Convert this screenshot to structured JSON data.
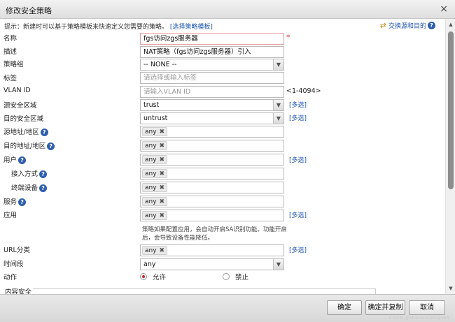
{
  "dialog": {
    "title": "修改安全策略",
    "close_glyph": "×"
  },
  "hint": {
    "text": "提示：新建时可以基于策略模板来快速定义您需要的策略。",
    "link": "[选择策略模板]"
  },
  "swap": {
    "label": "交换源和目的"
  },
  "form": {
    "name": {
      "label": "名称",
      "value": "fgs访问zgs服务器",
      "required": "*"
    },
    "description": {
      "label": "描述",
      "value": "NAT策略（fgs访问zgs服务器）引入"
    },
    "policy_group": {
      "label": "策略组",
      "value": "-- NONE --"
    },
    "tag": {
      "label": "标签",
      "placeholder": "请选择或输入标签"
    },
    "vlan": {
      "label": "VLAN ID",
      "placeholder": "请输入VLAN ID",
      "range": "<1-4094>"
    },
    "src_zone": {
      "label": "源安全区域",
      "value": "trust",
      "more": "[多选]"
    },
    "dst_zone": {
      "label": "目的安全区域",
      "value": "untrust",
      "more": "[多选]"
    },
    "src_addr": {
      "label": "源地址/地区",
      "tag": "any"
    },
    "dst_addr": {
      "label": "目的地址/地区",
      "tag": "any"
    },
    "user": {
      "label": "用户",
      "tag": "any",
      "more": "[多选]"
    },
    "access_mode": {
      "label": "接入方式",
      "tag": "any"
    },
    "terminal": {
      "label": "终端设备",
      "tag": "any"
    },
    "service": {
      "label": "服务",
      "tag": "any"
    },
    "application": {
      "label": "应用",
      "tag": "any",
      "more": "[多选]",
      "note": "策略如果配置应用，会自动开启SA识别功能。功能开启后，会导致设备性能降低。"
    },
    "url_category": {
      "label": "URL分类",
      "tag": "any",
      "more": "[多选]"
    },
    "time_range": {
      "label": "时间段",
      "value": "any"
    },
    "action": {
      "label": "动作",
      "allow": "允许",
      "deny": "禁止",
      "selected": "allow"
    },
    "content_security": {
      "label": "内容安全"
    }
  },
  "help_glyph": "?",
  "tag_remove_glyph": "✖",
  "select_arrow_glyph": "▼",
  "swap_icon_glyph": "⇄",
  "scroll": {
    "up": "▲",
    "down": "▼"
  },
  "buttons": {
    "ok": "确定",
    "ok_copy": "确定并复制",
    "cancel": "取消"
  },
  "watermark": "CSDN @sharonmeng365"
}
